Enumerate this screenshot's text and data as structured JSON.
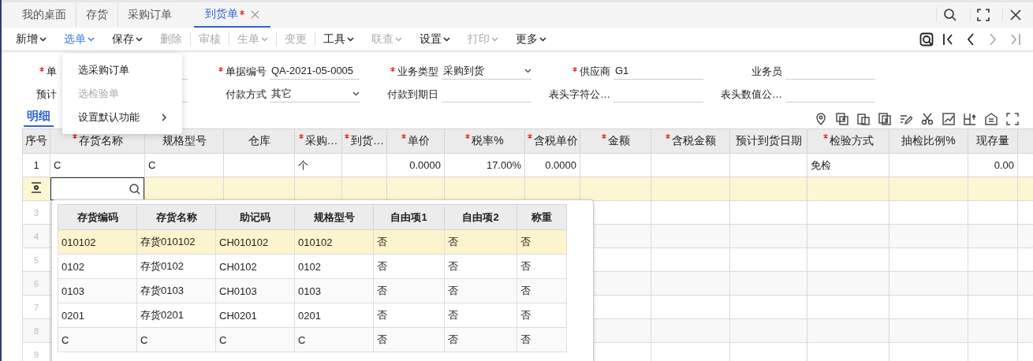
{
  "tabs": [
    {
      "label": "我的桌面",
      "selected": false,
      "modified": false,
      "closable": false
    },
    {
      "label": "存货",
      "selected": false,
      "modified": false,
      "closable": false
    },
    {
      "label": "采购订单",
      "selected": false,
      "modified": false,
      "closable": false
    },
    {
      "label": "到货单",
      "selected": true,
      "modified": true,
      "closable": true
    }
  ],
  "toolbar": [
    {
      "label": "新增",
      "dropdown": true,
      "disabled": false,
      "open": false,
      "divider_before": false
    },
    {
      "label": "选单",
      "dropdown": true,
      "disabled": false,
      "open": true,
      "divider_before": false
    },
    {
      "label": "保存",
      "dropdown": true,
      "disabled": false,
      "open": false,
      "divider_before": false
    },
    {
      "label": "删除",
      "dropdown": false,
      "disabled": true,
      "open": false,
      "divider_before": false
    },
    {
      "label": "审核",
      "dropdown": false,
      "disabled": true,
      "open": false,
      "divider_before": true
    },
    {
      "label": "生单",
      "dropdown": true,
      "disabled": true,
      "open": false,
      "divider_before": true
    },
    {
      "label": "变更",
      "dropdown": false,
      "disabled": true,
      "open": false,
      "divider_before": true
    },
    {
      "label": "工具",
      "dropdown": true,
      "disabled": false,
      "open": false,
      "divider_before": true
    },
    {
      "label": "联查",
      "dropdown": true,
      "disabled": true,
      "open": false,
      "divider_before": false
    },
    {
      "label": "设置",
      "dropdown": true,
      "disabled": false,
      "open": false,
      "divider_before": false
    },
    {
      "label": "打印",
      "dropdown": true,
      "disabled": true,
      "open": false,
      "divider_before": false
    },
    {
      "label": "更多",
      "dropdown": true,
      "disabled": false,
      "open": false,
      "divider_before": false
    }
  ],
  "nav_buttons": [
    {
      "kind": "preview",
      "disabled": false
    },
    {
      "kind": "first",
      "disabled": false
    },
    {
      "kind": "prev",
      "disabled": false
    },
    {
      "kind": "next",
      "disabled": true
    },
    {
      "kind": "last",
      "disabled": true
    }
  ],
  "select_menu": [
    {
      "label": "选采购订单",
      "disabled": false,
      "submenu": false
    },
    {
      "label": "选检验单",
      "disabled": true,
      "submenu": false
    },
    {
      "label": "设置默认功能",
      "disabled": false,
      "submenu": true
    }
  ],
  "form": [
    [
      {
        "label": "单",
        "required": true,
        "kind": "text"
      },
      {
        "label": "单据编号",
        "required": true,
        "kind": "text",
        "value": "QA-2021-05-0005"
      },
      {
        "label": "业务类型",
        "required": true,
        "kind": "select",
        "value": "采购到货"
      },
      {
        "label": "供应商",
        "required": true,
        "kind": "text",
        "value": "G1"
      },
      {
        "label": "业务员",
        "required": false,
        "kind": "text"
      }
    ],
    [
      {
        "label": "预计",
        "required": false,
        "kind": "text"
      },
      {
        "label": "付款方式",
        "required": false,
        "kind": "select",
        "value": "其它"
      },
      {
        "label": "付款到期日",
        "required": false,
        "kind": "text"
      },
      {
        "label": "表头字符公…",
        "required": false,
        "kind": "text"
      },
      {
        "label": "表头数值公…",
        "required": false,
        "kind": "text"
      }
    ]
  ],
  "detail_tab": {
    "label": "明细",
    "selected": true
  },
  "grid": {
    "columns": [
      {
        "label": "序号",
        "required": false
      },
      {
        "label": "存货名称",
        "required": true,
        "numeric": false
      },
      {
        "label": "规格型号",
        "required": false,
        "numeric": false
      },
      {
        "label": "仓库",
        "required": false
      },
      {
        "label": "采购…",
        "required": true,
        "numeric": false
      },
      {
        "label": "到货…",
        "required": true
      },
      {
        "label": "单价",
        "required": true,
        "numeric": true
      },
      {
        "label": "税率%",
        "required": true,
        "numeric": true
      },
      {
        "label": "含税单价",
        "required": true,
        "numeric": true
      },
      {
        "label": "金额",
        "required": true
      },
      {
        "label": "含税金额",
        "required": true
      },
      {
        "label": "预计到货日期",
        "required": false
      },
      {
        "label": "检验方式",
        "required": true,
        "numeric": false
      },
      {
        "label": "抽检比例%",
        "required": false
      },
      {
        "label": "现存量",
        "required": false,
        "numeric": true
      }
    ],
    "rows": [
      {
        "kind": "data",
        "cells": [
          "1",
          "C",
          "C",
          null,
          "个",
          null,
          "0.0000",
          "17.00%",
          "0.0000",
          null,
          null,
          null,
          "免检",
          null,
          "0.00"
        ]
      },
      {
        "kind": "editing"
      },
      {
        "kind": "empty",
        "number": "3"
      },
      {
        "kind": "empty",
        "number": "4"
      },
      {
        "kind": "empty",
        "number": "5"
      },
      {
        "kind": "empty",
        "number": "6"
      },
      {
        "kind": "empty",
        "number": "7"
      },
      {
        "kind": "empty",
        "number": "8"
      },
      {
        "kind": "empty",
        "number": "9"
      }
    ]
  },
  "lookup": {
    "columns": [
      "存货编码",
      "存货名称",
      "助记码",
      "规格型号",
      "自由项1",
      "自由项2",
      "称重"
    ],
    "rows": [
      {
        "selected": true,
        "cells": [
          "010102",
          "存货010102",
          "CH010102",
          "010102",
          "否",
          "否",
          "否"
        ]
      },
      {
        "selected": false,
        "cells": [
          "0102",
          "存货0102",
          "CH0102",
          "0102",
          "否",
          "否",
          "否"
        ]
      },
      {
        "selected": false,
        "cells": [
          "0103",
          "存货0103",
          "CH0103",
          "0103",
          "否",
          "否",
          "否"
        ]
      },
      {
        "selected": false,
        "cells": [
          "0201",
          "存货0201",
          "CH0201",
          "0201",
          "否",
          "否",
          "否"
        ]
      },
      {
        "selected": false,
        "cells": [
          "C",
          "C",
          "C",
          "C",
          "否",
          "否",
          "否"
        ]
      }
    ]
  }
}
